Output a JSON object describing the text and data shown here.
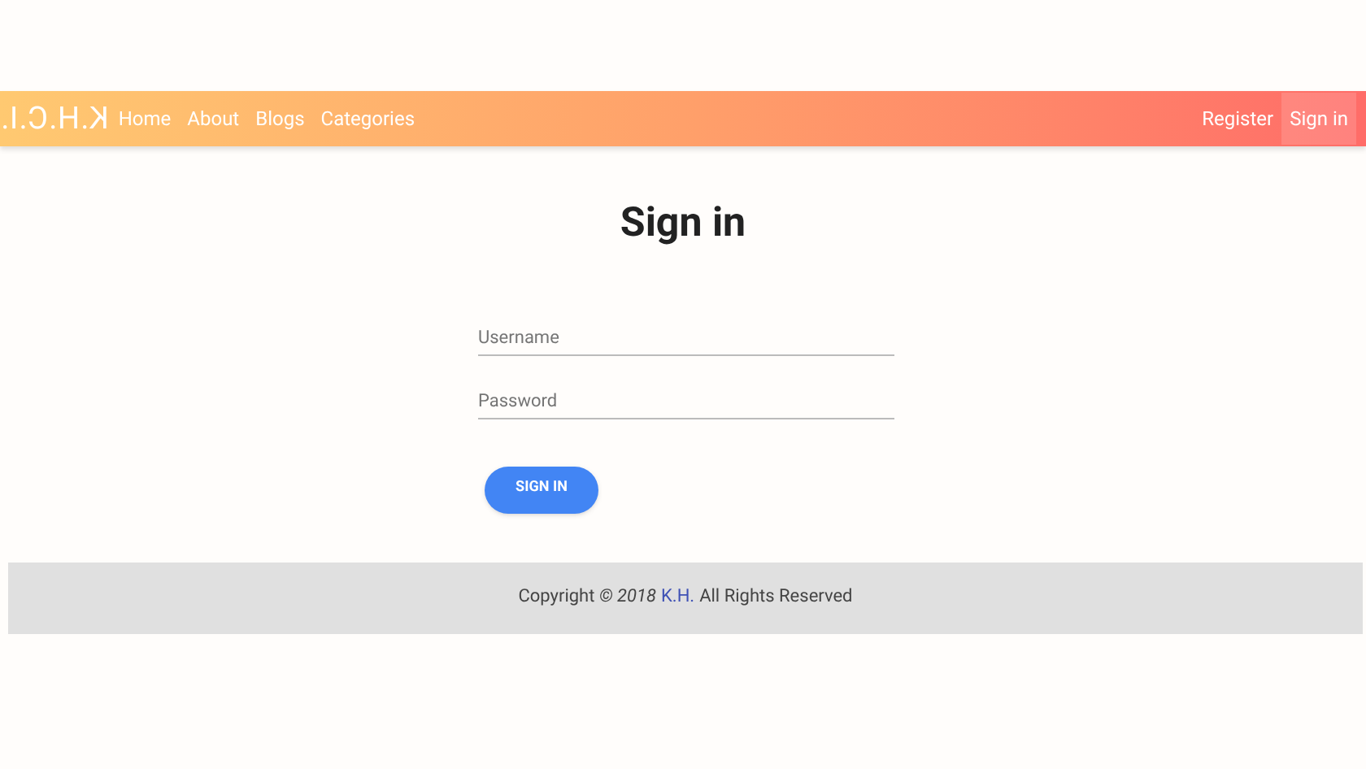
{
  "navbar": {
    "logo": "K.H.C.I.",
    "links": [
      {
        "label": "Home",
        "selected": false
      },
      {
        "label": "About",
        "selected": false
      },
      {
        "label": "Blogs",
        "selected": false
      },
      {
        "label": "Categories",
        "selected": false
      }
    ],
    "right_links": [
      {
        "label": "Register",
        "selected": false
      },
      {
        "label": "Sign in",
        "selected": true
      }
    ]
  },
  "heading": "Sign in",
  "fields": [
    {
      "placeholder": "Username"
    },
    {
      "placeholder": "Password"
    }
  ],
  "submit": "SIGN IN",
  "footer": {
    "text": "Copyright *© 2018*",
    "link": "K.H.",
    "text_after": "All Rights Reserved"
  }
}
